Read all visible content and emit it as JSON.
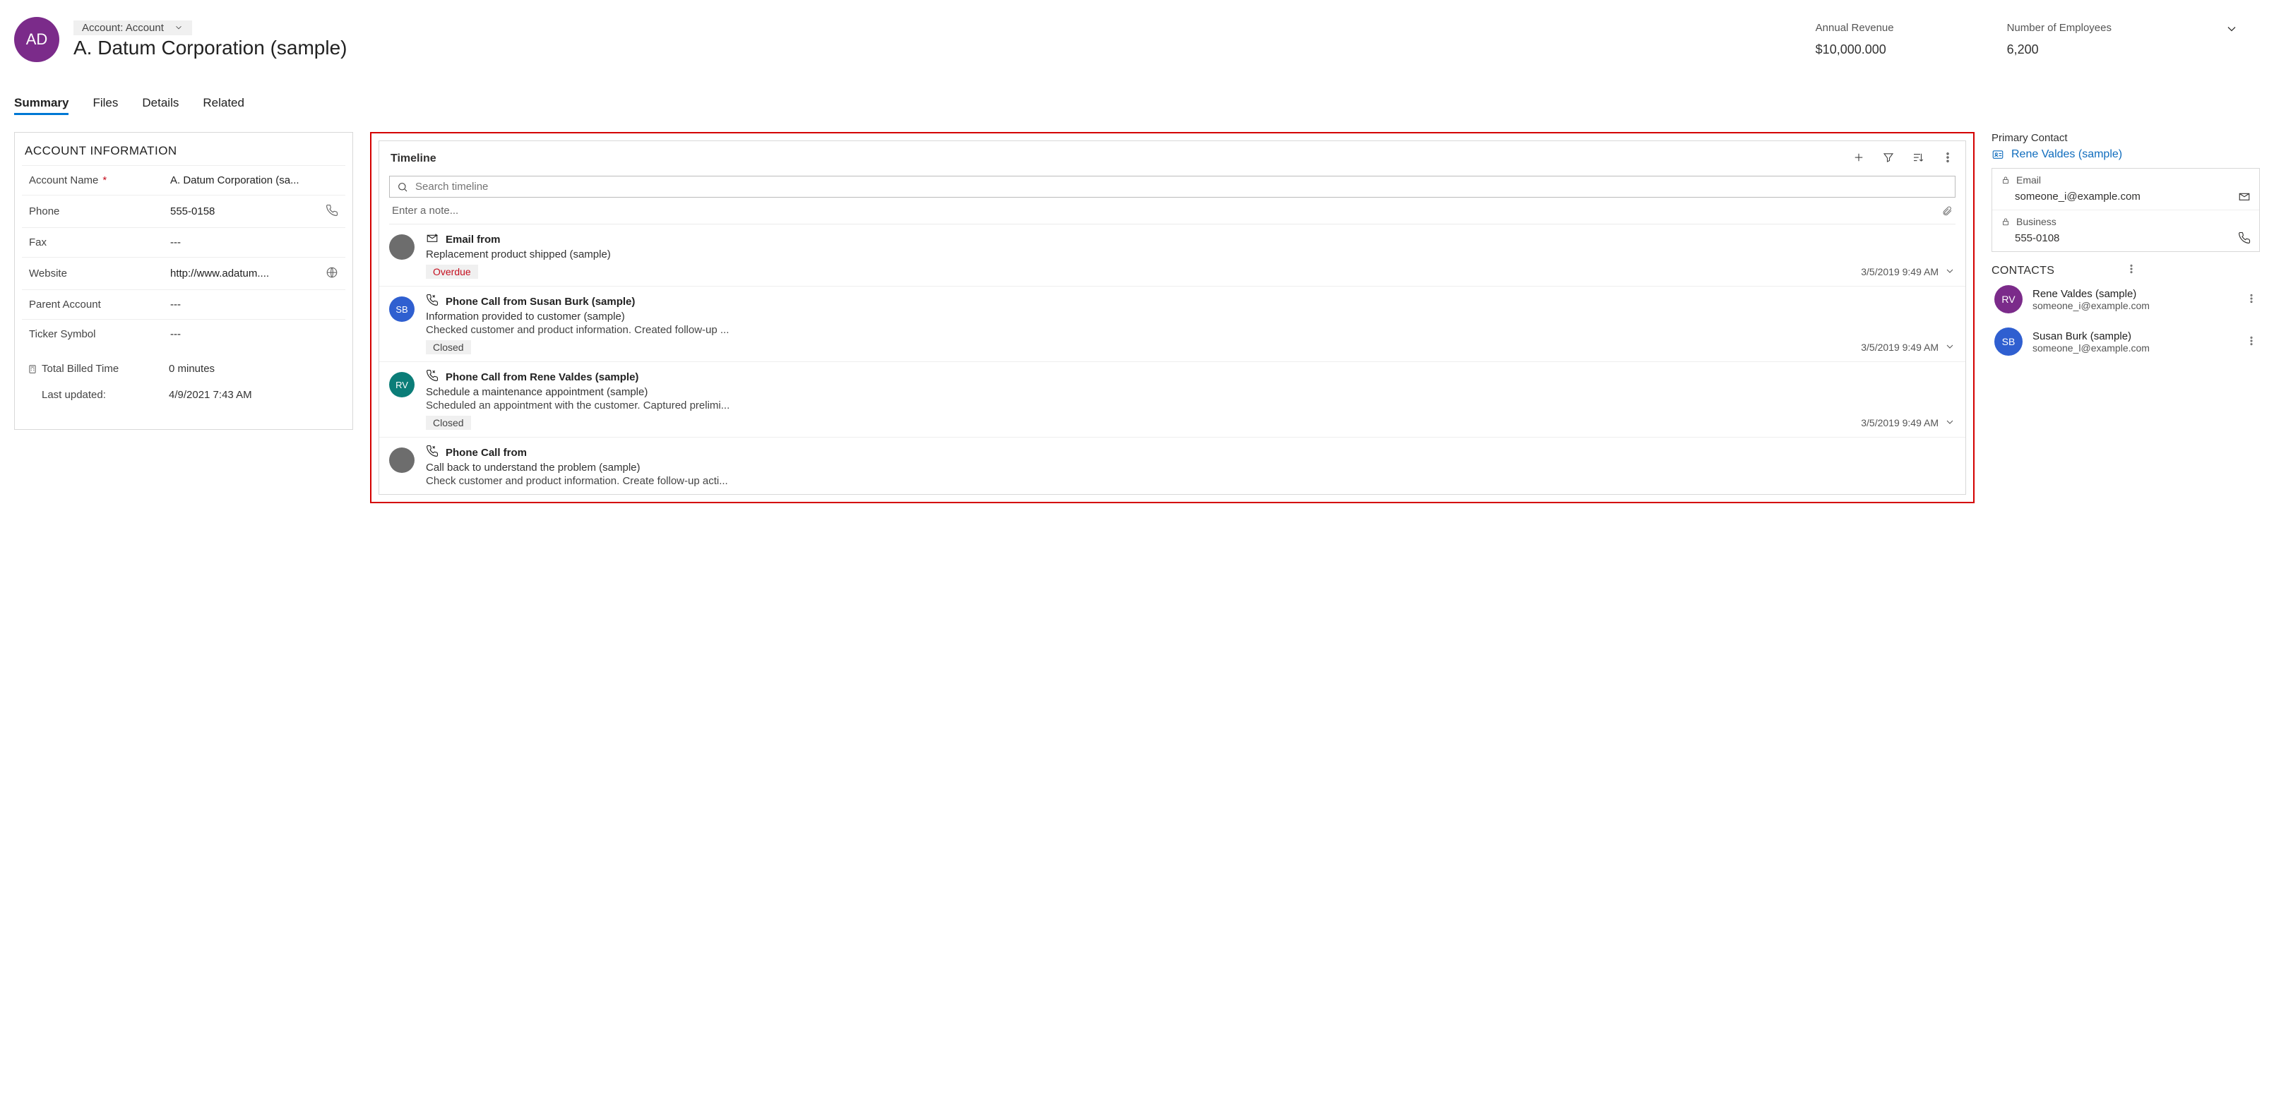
{
  "header": {
    "avatar_initials": "AD",
    "entity_label": "Account: Account",
    "title": "A. Datum Corporation (sample)",
    "stats": [
      {
        "label": "Annual Revenue",
        "value": "$10,000.000"
      },
      {
        "label": "Number of Employees",
        "value": "6,200"
      }
    ]
  },
  "tabs": [
    "Summary",
    "Files",
    "Details",
    "Related"
  ],
  "active_tab": "Summary",
  "account_info": {
    "section_title": "ACCOUNT INFORMATION",
    "fields": {
      "account_name": {
        "label": "Account Name",
        "value": "A. Datum Corporation (sa...",
        "required": true
      },
      "phone": {
        "label": "Phone",
        "value": "555-0158",
        "icon": "phone"
      },
      "fax": {
        "label": "Fax",
        "value": "---"
      },
      "website": {
        "label": "Website",
        "value": "http://www.adatum....",
        "icon": "globe"
      },
      "parent": {
        "label": "Parent Account",
        "value": "---"
      },
      "ticker": {
        "label": "Ticker Symbol",
        "value": "---"
      }
    },
    "billed_time": {
      "label": "Total Billed Time",
      "value": "0 minutes"
    },
    "last_updated": {
      "label": "Last updated:",
      "value": "4/9/2021 7:43 AM"
    }
  },
  "timeline": {
    "title": "Timeline",
    "search_placeholder": "Search timeline",
    "note_placeholder": "Enter a note...",
    "items": [
      {
        "avatar": "",
        "avatar_color": "#6d6d6d",
        "icon": "mail",
        "heading": "Email from",
        "subject": "Replacement product shipped (sample)",
        "description": "",
        "status": "Overdue",
        "status_kind": "overdue",
        "timestamp": "3/5/2019 9:49 AM"
      },
      {
        "avatar": "SB",
        "avatar_color": "#2f5fd0",
        "icon": "phone",
        "heading": "Phone Call from Susan Burk (sample)",
        "subject": "Information provided to customer (sample)",
        "description": "Checked customer and product information. Created follow-up ...",
        "status": "Closed",
        "status_kind": "closed",
        "timestamp": "3/5/2019 9:49 AM"
      },
      {
        "avatar": "RV",
        "avatar_color": "#0b7d78",
        "icon": "phone",
        "heading": "Phone Call from Rene Valdes (sample)",
        "subject": "Schedule a maintenance appointment (sample)",
        "description": "Scheduled an appointment with the customer. Captured prelimi...",
        "status": "Closed",
        "status_kind": "closed",
        "timestamp": "3/5/2019 9:49 AM"
      },
      {
        "avatar": "",
        "avatar_color": "#6d6d6d",
        "icon": "phone",
        "heading": "Phone Call from",
        "subject": "Call back to understand the problem (sample)",
        "description": "Check customer and product information. Create follow-up acti...",
        "status": "",
        "status_kind": "",
        "timestamp": ""
      }
    ]
  },
  "primary_contact": {
    "title": "Primary Contact",
    "name": "Rene Valdes (sample)",
    "email": {
      "label": "Email",
      "value": "someone_i@example.com"
    },
    "business": {
      "label": "Business",
      "value": "555-0108"
    }
  },
  "contacts": {
    "title": "CONTACTS",
    "items": [
      {
        "initials": "RV",
        "color": "#7b2b8a",
        "name": "Rene Valdes (sample)",
        "email": "someone_i@example.com"
      },
      {
        "initials": "SB",
        "color": "#2f5fd0",
        "name": "Susan Burk (sample)",
        "email": "someone_l@example.com"
      }
    ]
  }
}
